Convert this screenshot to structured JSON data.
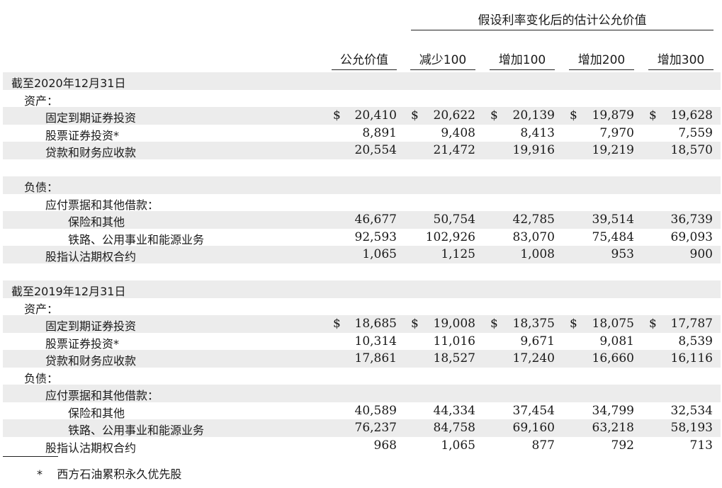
{
  "header": {
    "super_title": "假设利率变化后的估计公允价值",
    "columns": [
      "公允价值",
      "减少100",
      "增加100",
      "增加200",
      "增加300"
    ]
  },
  "rows": [
    {
      "label": "截至2020年12月31日",
      "indent": 0,
      "shade": true,
      "values": []
    },
    {
      "label": "资产：",
      "indent": 1,
      "shade": false,
      "values": []
    },
    {
      "label": "固定到期证券投资",
      "indent": 2,
      "shade": true,
      "dollar": true,
      "values": [
        "20,410",
        "20,622",
        "20,139",
        "19,879",
        "19,628"
      ]
    },
    {
      "label": "股票证券投资*",
      "indent": 2,
      "shade": false,
      "values": [
        "8,891",
        "9,408",
        "8,413",
        "7,970",
        "7,559"
      ]
    },
    {
      "label": "贷款和财务应收款",
      "indent": 2,
      "shade": true,
      "values": [
        "20,554",
        "21,472",
        "19,916",
        "19,219",
        "18,570"
      ]
    },
    {
      "label": "",
      "indent": 0,
      "shade": false,
      "values": []
    },
    {
      "label": "负债：",
      "indent": 1,
      "shade": true,
      "values": []
    },
    {
      "label": "应付票据和其他借款：",
      "indent": 2,
      "shade": false,
      "values": []
    },
    {
      "label": "保险和其他",
      "indent": 3,
      "shade": true,
      "values": [
        "46,677",
        "50,754",
        "42,785",
        "39,514",
        "36,739"
      ]
    },
    {
      "label": "铁路、公用事业和能源业务",
      "indent": 3,
      "shade": false,
      "values": [
        "92,593",
        "102,926",
        "83,070",
        "75,484",
        "69,093"
      ]
    },
    {
      "label": "股指认沽期权合约",
      "indent": 2,
      "shade": true,
      "values": [
        "1,065",
        "1,125",
        "1,008",
        "953",
        "900"
      ]
    },
    {
      "label": "",
      "indent": 0,
      "shade": false,
      "values": []
    },
    {
      "label": "截至2019年12月31日",
      "indent": 0,
      "shade": true,
      "values": []
    },
    {
      "label": "资产：",
      "indent": 1,
      "shade": false,
      "values": []
    },
    {
      "label": "固定到期证券投资",
      "indent": 2,
      "shade": true,
      "dollar": true,
      "values": [
        "18,685",
        "19,008",
        "18,375",
        "18,075",
        "17,787"
      ]
    },
    {
      "label": "股票证券投资*",
      "indent": 2,
      "shade": false,
      "values": [
        "10,314",
        "11,016",
        "9,671",
        "9,081",
        "8,539"
      ]
    },
    {
      "label": "贷款和财务应收款",
      "indent": 2,
      "shade": true,
      "values": [
        "17,861",
        "18,527",
        "17,240",
        "16,660",
        "16,116"
      ]
    },
    {
      "label": "负债：",
      "indent": 1,
      "shade": false,
      "values": []
    },
    {
      "label": "应付票据和其他借款：",
      "indent": 2,
      "shade": true,
      "values": []
    },
    {
      "label": "保险和其他",
      "indent": 3,
      "shade": false,
      "values": [
        "40,589",
        "44,334",
        "37,454",
        "34,799",
        "32,534"
      ]
    },
    {
      "label": "铁路、公用事业和能源业务",
      "indent": 3,
      "shade": true,
      "values": [
        "76,237",
        "84,758",
        "69,160",
        "63,218",
        "58,193"
      ]
    },
    {
      "label": "股指认沽期权合约",
      "indent": 2,
      "shade": false,
      "values": [
        "968",
        "1,065",
        "877",
        "792",
        "713"
      ]
    }
  ],
  "currency_symbol": "$",
  "footnote": {
    "marker": "*",
    "text": "西方石油累积永久优先股"
  }
}
